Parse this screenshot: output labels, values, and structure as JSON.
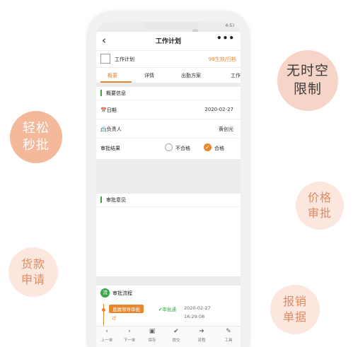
{
  "bubbles": {
    "anytime": "无时空\n限制",
    "quick": "轻松\n秒批",
    "price": "价格\n审批",
    "loan": "货款\n申请",
    "expense": "报销\n单据"
  },
  "status_bar": {
    "time": "4:57"
  },
  "header": {
    "back_icon": "back-arrow-icon",
    "title": "工作计划",
    "more_label": "•••"
  },
  "document": {
    "title": "工作计划",
    "status": "99生效/归档"
  },
  "tabs": [
    {
      "label": "概要"
    },
    {
      "label": "详情"
    },
    {
      "label": "出勤方案"
    },
    {
      "label": "工作"
    }
  ],
  "overview": {
    "section_title": "概要信息",
    "date_label": "日期",
    "date_value": "2020-02-27",
    "owner_label": "负责人",
    "owner_value": "黄创光",
    "result_label": "审批结果",
    "option_fail": "不合格",
    "option_pass": "合格",
    "selected": "合格"
  },
  "opinion": {
    "section_title": "审批意见"
  },
  "flow": {
    "section_title": "审批流程",
    "icon_text": "流",
    "step_tag": "直属领导审批",
    "step_sub": "过",
    "step_status": "审批通",
    "step_date": "2020-02-27",
    "step_time": "16:29:08"
  },
  "toolbar": [
    {
      "icon": "chevron-left-icon",
      "glyph": "‹",
      "label": "上一单"
    },
    {
      "icon": "chevron-right-icon",
      "glyph": "›",
      "label": "下一单"
    },
    {
      "icon": "save-icon",
      "glyph": "▣",
      "label": "保存"
    },
    {
      "icon": "check-icon",
      "glyph": "✔",
      "label": "提交"
    },
    {
      "icon": "arrow-circle-icon",
      "glyph": "➔",
      "label": "流程"
    },
    {
      "icon": "wrench-icon",
      "glyph": "✎",
      "label": "工具"
    }
  ],
  "colors": {
    "accent": "#e8862e",
    "green": "#39a64a"
  }
}
